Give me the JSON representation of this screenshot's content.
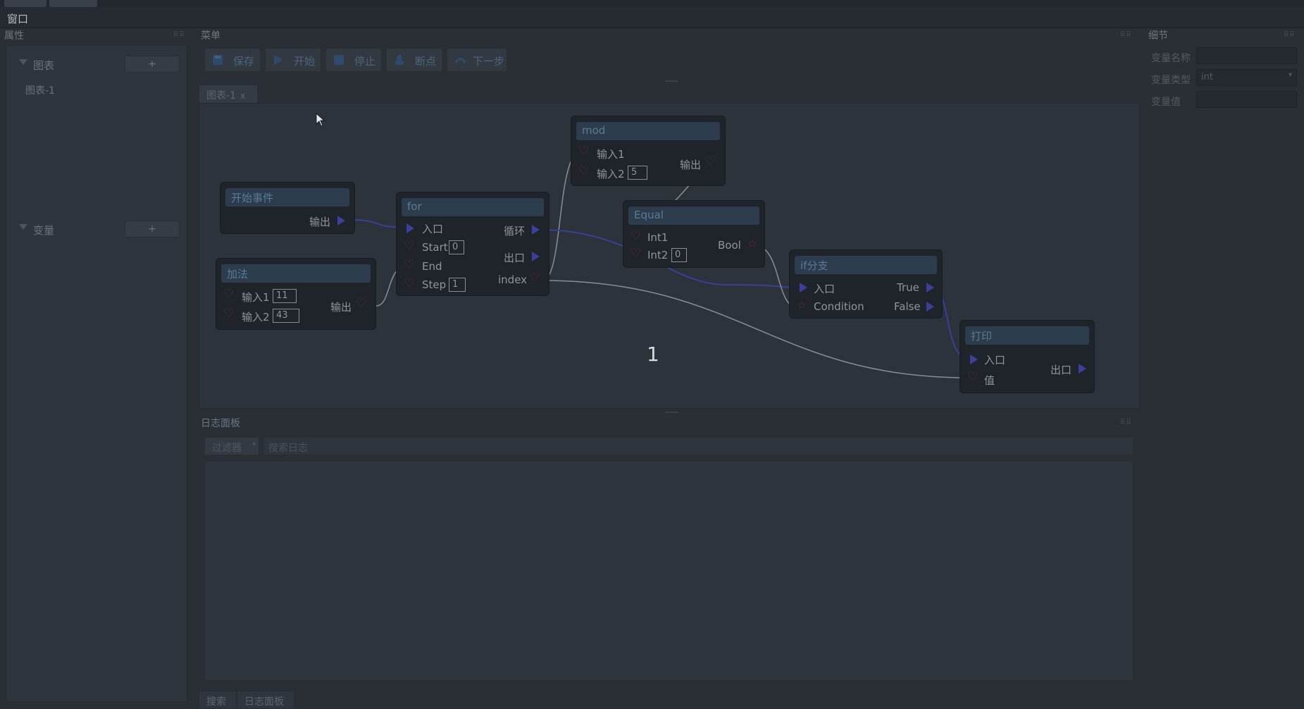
{
  "menubar": {
    "window_menu": "窗口"
  },
  "panels": {
    "left_title": "属性",
    "menu_title": "菜单",
    "detail_title": "细节",
    "log_title": "日志面板"
  },
  "left": {
    "graphs_section": "图表",
    "graphs_add": "+",
    "graph_item": "图表-1",
    "vars_section": "变量",
    "vars_add": "+"
  },
  "toolbar": {
    "save": "保存",
    "start": "开始",
    "stop": "停止",
    "breakpoint": "断点",
    "step": "下一步"
  },
  "graph_tab": {
    "label": "图表-1",
    "close": "x"
  },
  "nodes": {
    "start_event": {
      "title": "开始事件",
      "out": "输出"
    },
    "add": {
      "title": "加法",
      "in1": "输入1",
      "in1_val": "11",
      "in2": "输入2",
      "in2_val": "43",
      "out": "输出"
    },
    "for": {
      "title": "for",
      "entry": "入口",
      "start": "Start",
      "start_val": "0",
      "end": "End",
      "step": "Step",
      "step_val": "1",
      "loop": "循环",
      "exit": "出口",
      "index": "index"
    },
    "mod": {
      "title": "mod",
      "in1": "输入1",
      "in2": "输入2",
      "in2_val": "5",
      "out": "输出"
    },
    "equal": {
      "title": "Equal",
      "int1": "Int1",
      "int2": "Int2",
      "int2_val": "0",
      "bool": "Bool"
    },
    "if": {
      "title": "if分支",
      "entry": "入口",
      "condition": "Condition",
      "true": "True",
      "false": "False"
    },
    "print": {
      "title": "打印",
      "entry": "入口",
      "value": "值",
      "exit": "出口"
    }
  },
  "canvas_value": "1",
  "detail": {
    "var_name_label": "变量名称",
    "var_name_value": "",
    "var_type_label": "变量类型",
    "var_type_value": "int",
    "var_value_label": "变量值",
    "var_value_value": ""
  },
  "log": {
    "filter": "过滤器",
    "search_placeholder": "搜索日志"
  },
  "bottom_tabs": [
    "搜索",
    "日志面板"
  ],
  "colors": {
    "background": "#2a2f36",
    "node_title_bg": "#2d3d4d",
    "exec_pin": "#3d3f9c",
    "data_pin": "#6b2b38",
    "wire_exec": "#3b3f9a",
    "wire_data": "#8a8e94"
  }
}
